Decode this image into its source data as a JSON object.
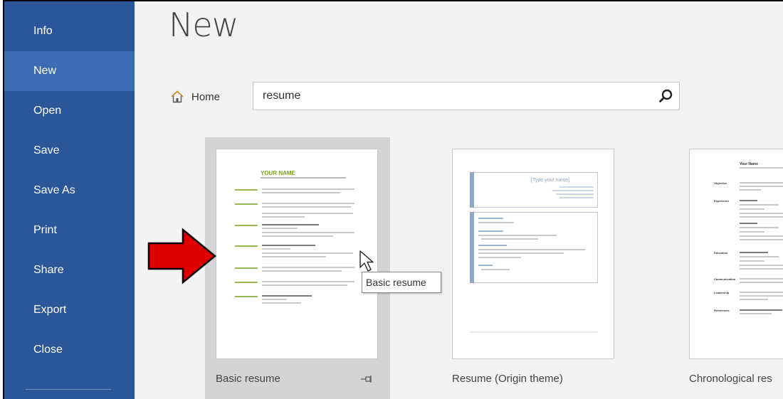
{
  "sidebar": {
    "items": [
      {
        "label": "Info"
      },
      {
        "label": "New"
      },
      {
        "label": "Open"
      },
      {
        "label": "Save"
      },
      {
        "label": "Save As"
      },
      {
        "label": "Print"
      },
      {
        "label": "Share"
      },
      {
        "label": "Export"
      },
      {
        "label": "Close"
      }
    ],
    "active": "New"
  },
  "main": {
    "title": "New",
    "home_label": "Home",
    "search": {
      "value": "resume",
      "placeholder": ""
    },
    "templates": [
      {
        "label": "Basic resume",
        "selected": true
      },
      {
        "label": "Resume (Origin theme)",
        "selected": false
      },
      {
        "label": "Chronological res",
        "selected": false
      }
    ],
    "tooltip": "Basic resume",
    "thumb_basic": {
      "name": "YOUR NAME"
    },
    "thumb_origin": {
      "name": "[Type your name]"
    },
    "thumb_chrono": {
      "name": "Your Name",
      "sections": [
        "Objective",
        "Experience",
        "Education",
        "Communication",
        "Leadership",
        "References"
      ]
    }
  },
  "colors": {
    "sidebar": "#2b579a",
    "sidebar_active": "#3d6bb1",
    "accent_arrow": "#e00000",
    "resume_green": "#7ea22c"
  }
}
